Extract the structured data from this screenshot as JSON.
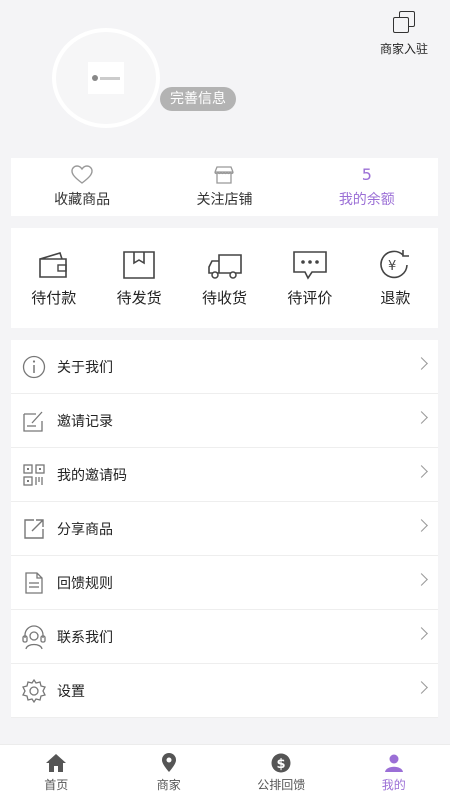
{
  "header": {
    "merchant_entry_label": "商家入驻",
    "complete_info_label": "完善信息"
  },
  "stats": [
    {
      "value": "",
      "label": "收藏商品",
      "icon": "heart-icon"
    },
    {
      "value": "",
      "label": "关注店铺",
      "icon": "shop-icon"
    },
    {
      "value": "5",
      "label": "我的余额",
      "icon": ""
    }
  ],
  "orders": [
    {
      "label": "待付款",
      "icon": "wallet-icon"
    },
    {
      "label": "待发货",
      "icon": "box-icon"
    },
    {
      "label": "待收货",
      "icon": "truck-icon"
    },
    {
      "label": "待评价",
      "icon": "comment-icon"
    },
    {
      "label": "退款",
      "icon": "refund-icon"
    }
  ],
  "menu": [
    {
      "label": "关于我们",
      "icon": "info-icon"
    },
    {
      "label": "邀请记录",
      "icon": "edit-record-icon"
    },
    {
      "label": "我的邀请码",
      "icon": "qrcode-icon"
    },
    {
      "label": "分享商品",
      "icon": "share-icon"
    },
    {
      "label": "回馈规则",
      "icon": "document-icon"
    },
    {
      "label": "联系我们",
      "icon": "headset-icon"
    },
    {
      "label": "设置",
      "icon": "gear-icon"
    }
  ],
  "tabs": [
    {
      "label": "首页",
      "icon": "home-icon"
    },
    {
      "label": "商家",
      "icon": "location-pin-icon"
    },
    {
      "label": "公排回馈",
      "icon": "dollar-icon"
    },
    {
      "label": "我的",
      "icon": "person-icon"
    }
  ],
  "colors": {
    "accent": "#9b6fd6",
    "background": "#f4f4f6"
  }
}
